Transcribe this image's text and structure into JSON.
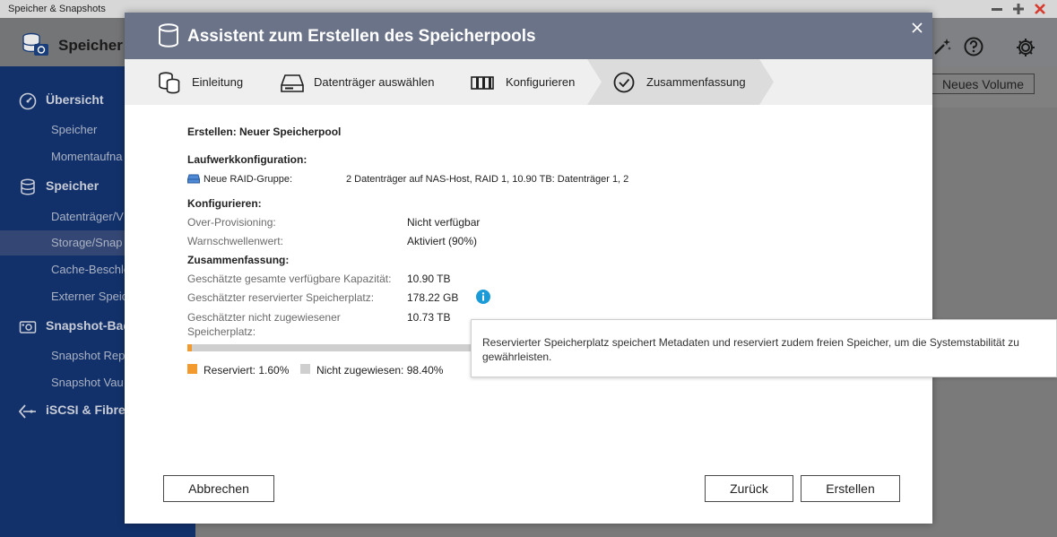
{
  "app": {
    "window_title": "Speicher & Snapshots",
    "name": "Speicher &",
    "new_volume_button": "Neues Volume"
  },
  "sidebar": {
    "groups": [
      {
        "label": "Übersicht",
        "icon": "gauge-icon"
      },
      {
        "label": "Speicher",
        "icon": "database-icon"
      },
      {
        "label": "Snapshot-Bac",
        "icon": "snapshot-icon"
      },
      {
        "label": "iSCSI & Fibre C",
        "icon": "iscsi-icon"
      }
    ],
    "items": [
      {
        "label": "Speicher",
        "active": false
      },
      {
        "label": "Momentaufna",
        "active": false
      },
      {
        "label": "Datenträger/V",
        "active": false
      },
      {
        "label": "Storage/Snap",
        "active": true
      },
      {
        "label": "Cache-Beschle",
        "active": false
      },
      {
        "label": "Externer Speic",
        "active": false
      },
      {
        "label": "Snapshot Rep",
        "active": false
      },
      {
        "label": "Snapshot Vau",
        "active": false
      }
    ]
  },
  "dialog": {
    "title": "Assistent zum Erstellen des Speicherpools",
    "steps": [
      {
        "label": "Einleitung",
        "icon": "database-icon"
      },
      {
        "label": "Datenträger auswählen",
        "icon": "disk-drive-icon"
      },
      {
        "label": "Konfigurieren",
        "icon": "raid-config-icon"
      },
      {
        "label": "Zusammenfassung",
        "icon": "check-circle-icon",
        "active": true
      }
    ],
    "create_heading": "Erstellen: Neuer Speicherpool",
    "drive_config_heading": "Laufwerkkonfiguration:",
    "raid_group_label": "Neue RAID-Gruppe:",
    "raid_group_value": "2 Datenträger auf NAS-Host, RAID 1, 10.90 TB: Datenträger 1, 2",
    "configure_heading": "Konfigurieren:",
    "over_provisioning_label": "Over-Provisioning:",
    "over_provisioning_value": "Nicht verfügbar",
    "threshold_label": "Warnschwellenwert:",
    "threshold_value": "Aktiviert (90%)",
    "summary_heading": "Zusammenfassung:",
    "total_capacity_label": "Geschätzte gesamte verfügbare Kapazität:",
    "total_capacity_value": "10.90 TB",
    "reserved_label": "Geschätzter reservierter Speicherplatz:",
    "reserved_value": "178.22 GB",
    "unallocated_label_line1": "Geschätzter nicht zugewiesener",
    "unallocated_label_line2": "Speicherplatz:",
    "unallocated_value": "10.73 TB",
    "usage_bar": {
      "reserved_percent": 1.6,
      "unallocated_percent": 98.4
    },
    "legend_reserved": "Reserviert: 1.60%",
    "legend_unallocated": "Nicht zugewiesen: 98.40%",
    "cancel_button": "Abbrechen",
    "back_button": "Zurück",
    "create_button": "Erstellen"
  },
  "tooltip": {
    "text": "Reservierter Speicherplatz speichert Metadaten und reserviert zudem freien Speicher, um die Systemstabilität zu gewährleisten."
  },
  "colors": {
    "sidebar": "#12316b",
    "dialog_header": "#6b7388",
    "reserved": "#f29a2e",
    "unallocated": "#cfcfcf",
    "info": "#1a9bd7"
  }
}
